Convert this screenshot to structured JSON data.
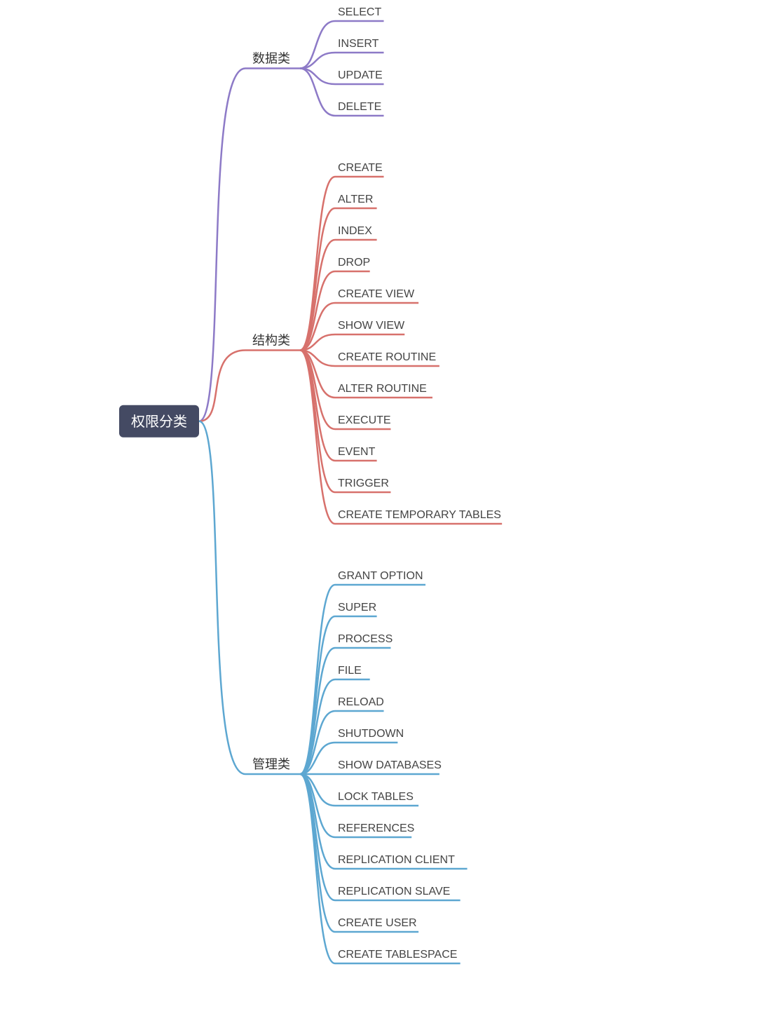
{
  "root": {
    "label": "权限分类"
  },
  "colors": {
    "root_fill": "#444a63",
    "root_text": "#ffffff"
  },
  "categories": [
    {
      "id": "data",
      "label": "数据类",
      "color": "#8d7ac7",
      "items": [
        "SELECT",
        "INSERT",
        "UPDATE",
        "DELETE"
      ]
    },
    {
      "id": "structure",
      "label": "结构类",
      "color": "#d7716c",
      "items": [
        "CREATE",
        "ALTER",
        "INDEX",
        "DROP",
        "CREATE VIEW",
        "SHOW VIEW",
        "CREATE ROUTINE",
        "ALTER ROUTINE",
        "EXECUTE",
        "EVENT",
        "TRIGGER",
        "CREATE TEMPORARY TABLES"
      ]
    },
    {
      "id": "admin",
      "label": "管理类",
      "color": "#5da7d1",
      "items": [
        "GRANT OPTION",
        "SUPER",
        "PROCESS",
        "FILE",
        "RELOAD",
        "SHUTDOWN",
        "SHOW DATABASES",
        "LOCK TABLES",
        "REFERENCES",
        "REPLICATION CLIENT",
        "REPLICATION SLAVE",
        "CREATE USER",
        "CREATE TABLESPACE"
      ]
    }
  ]
}
